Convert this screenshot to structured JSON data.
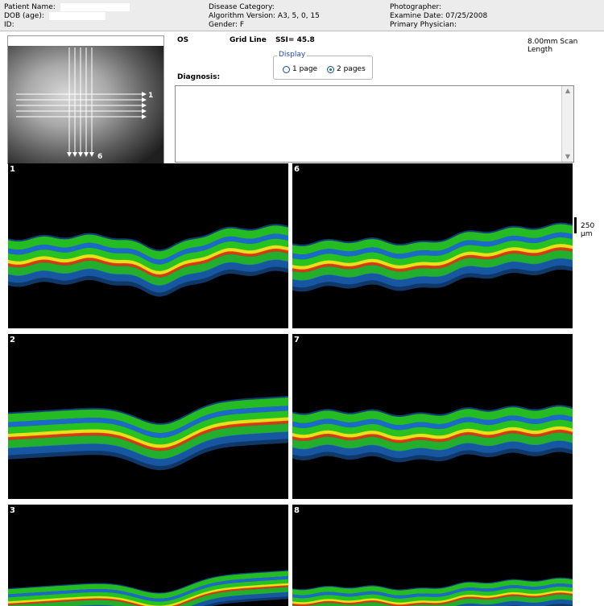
{
  "header": {
    "col1": [
      "Patient Name:",
      "DOB (age):",
      "ID:"
    ],
    "col2": [
      "Disease Category:",
      "Algorithm Version: A3, 5, 0, 15",
      "Gender: F"
    ],
    "col3": [
      "Photographer:",
      "Examine Date: 07/25/2008",
      "Primary Physician:"
    ]
  },
  "info": {
    "eye": "OS",
    "grid": "Grid Line",
    "ssi": "SSI= 45.8",
    "scan_length": "8.00mm Scan Length",
    "diagnosis_label": "Diagnosis:"
  },
  "display": {
    "legend": "Display",
    "options": [
      "1 page",
      "2 pages"
    ],
    "selected": "2 pages"
  },
  "fundus": {
    "h_label": "1",
    "v_label": "6"
  },
  "scale": {
    "label": "250 µm"
  },
  "scans": [
    {
      "num": "1"
    },
    {
      "num": "6"
    },
    {
      "num": "2"
    },
    {
      "num": "7"
    },
    {
      "num": "3"
    },
    {
      "num": "8"
    }
  ],
  "colors": {
    "oct_outer": "#1e6fd0",
    "oct_green": "#27c21f",
    "oct_yellow": "#e7e01b",
    "oct_red": "#e03a12"
  }
}
